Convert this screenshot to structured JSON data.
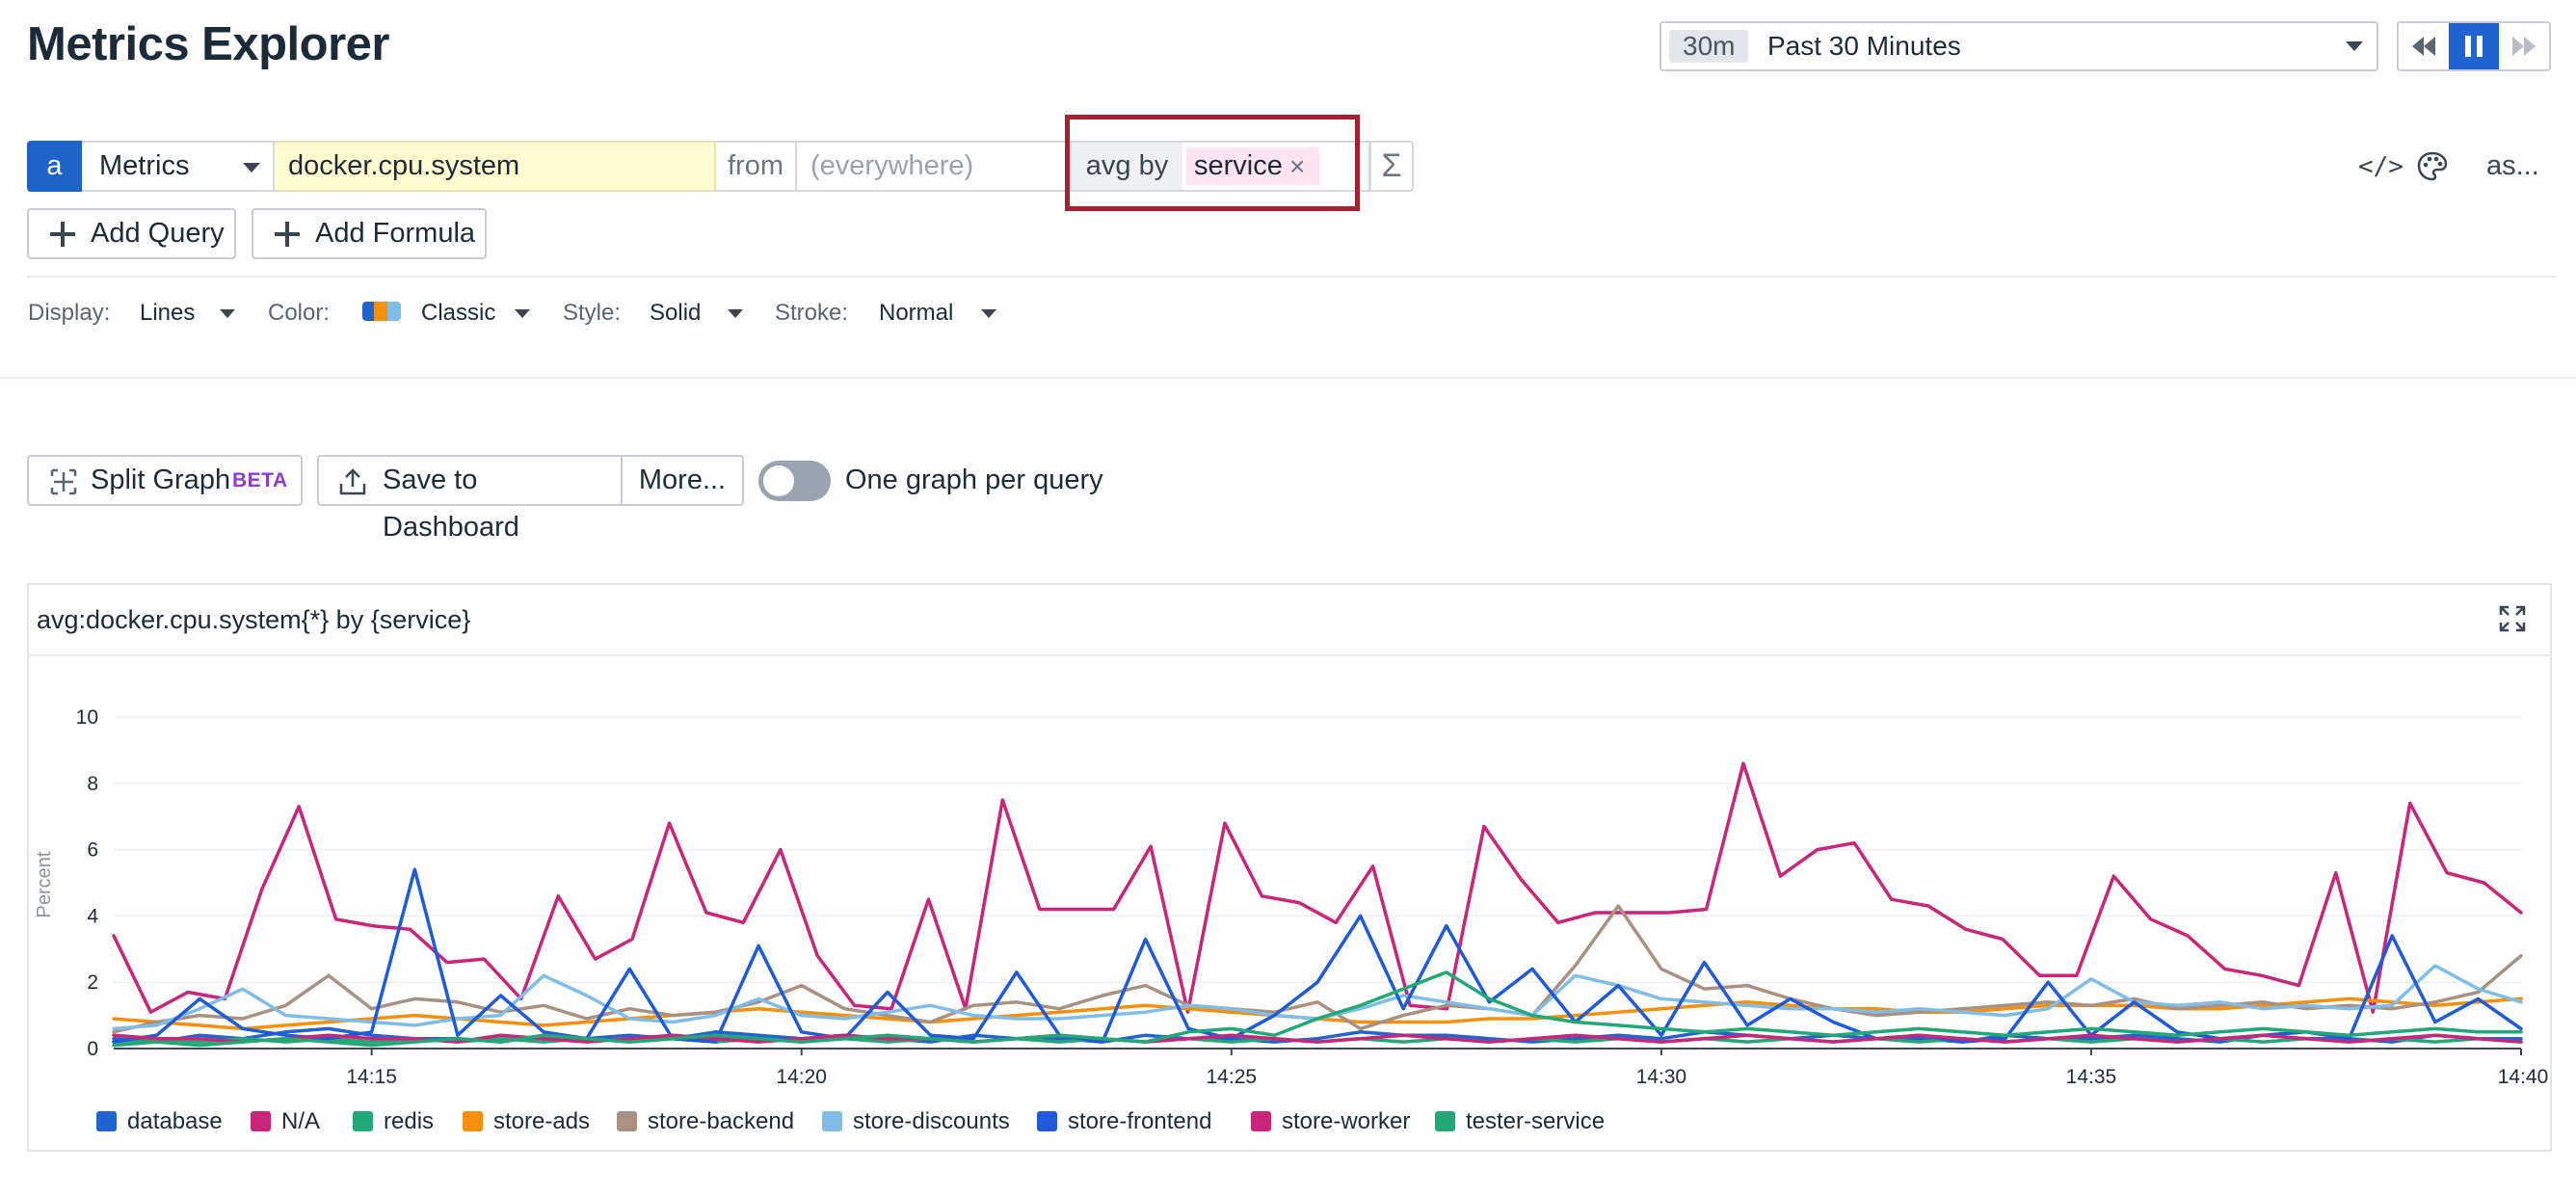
{
  "header": {
    "title": "Metrics Explorer"
  },
  "timepicker": {
    "badge": "30m",
    "label": "Past 30 Minutes"
  },
  "query": {
    "letter": "a",
    "source": "Metrics",
    "metric": "docker.cpu.system",
    "from_label": "from",
    "from_placeholder": "(everywhere)",
    "aggregation": "avg by",
    "group_tag": "service",
    "remove_glyph": "×",
    "sigma": "Σ",
    "code_icon": "</>",
    "as_label": "as..."
  },
  "actions": {
    "add_query": "Add Query",
    "add_formula": "Add Formula"
  },
  "options": {
    "display_label": "Display:",
    "display_value": "Lines",
    "color_label": "Color:",
    "color_value": "Classic",
    "style_label": "Style:",
    "style_value": "Solid",
    "stroke_label": "Stroke:",
    "stroke_value": "Normal"
  },
  "toolbar": {
    "split_graph": "Split Graph",
    "beta": "BETA",
    "save_dashboard": "Save to Dashboard",
    "more": "More...",
    "one_graph_label": "One graph per query",
    "one_graph_on": false
  },
  "panel": {
    "title": "avg:docker.cpu.system{*} by {service}"
  },
  "colors": {
    "accent": "#1f64cf",
    "highlight_border": "#a3212c"
  },
  "chart_data": {
    "type": "line",
    "ylabel": "Percent",
    "ylim": [
      0,
      10
    ],
    "yticks": [
      "0",
      "2",
      "4",
      "6",
      "8",
      "10"
    ],
    "x_minutes_from_1412": [
      0,
      0.5,
      1,
      1.5,
      2,
      2.5,
      3,
      3.5,
      4,
      4.5,
      5,
      5.5,
      6,
      6.5,
      7,
      7.5,
      8,
      8.5,
      9,
      9.5,
      10,
      10.5,
      11,
      11.5,
      12,
      12.5,
      13,
      13.5,
      14,
      14.5,
      15,
      15.5,
      16,
      16.5,
      17,
      17.5,
      18,
      18.5,
      19,
      19.5,
      20,
      20.5,
      21,
      21.5,
      22,
      22.5,
      23,
      23.5,
      24,
      24.5,
      25,
      25.5,
      26,
      26.5,
      27,
      27.5,
      28
    ],
    "xticks": [
      "14:15",
      "14:20",
      "14:25",
      "14:30",
      "14:35",
      "14:40"
    ],
    "series": [
      {
        "name": "database",
        "color": "#1f64cf",
        "values": [
          0.3,
          0.2,
          0.4,
          0.3,
          0.5,
          0.6,
          0.4,
          0.3,
          0.3,
          0.2,
          0.4,
          0.3,
          0.4,
          0.3,
          0.5,
          0.4,
          0.3,
          0.4,
          0.3,
          0.2,
          0.4,
          0.3,
          0.3,
          0.2,
          0.4,
          0.3,
          0.3,
          0.2,
          0.3,
          0.5,
          0.4,
          0.4,
          0.3,
          0.2,
          0.3,
          0.4,
          0.3,
          0.5,
          0.4,
          0.3,
          0.4,
          0.3,
          0.3,
          0.2,
          0.4,
          0.3,
          0.3,
          0.4,
          0.3,
          0.2,
          0.4,
          0.3,
          0.3,
          0.2,
          0.4,
          0.3,
          0.3
        ]
      },
      {
        "name": "N/A",
        "color": "#c9267a",
        "values": [
          3.4,
          1.1,
          1.7,
          1.5,
          4.8,
          7.3,
          3.9,
          3.7,
          3.6,
          2.6,
          2.7,
          1.5,
          4.6,
          2.7,
          3.3,
          6.8,
          4.1,
          3.8,
          6.0,
          2.8,
          1.3,
          1.2,
          4.5,
          1.2,
          7.5,
          4.2,
          4.2,
          4.2,
          6.1,
          1.1,
          6.8,
          4.6,
          4.4,
          3.8,
          5.5,
          1.3,
          1.2,
          6.7,
          5.1,
          3.8,
          4.1,
          4.1,
          4.1,
          4.2,
          8.6,
          5.2,
          6.0,
          6.2,
          4.5,
          4.3,
          3.6,
          3.3,
          2.2,
          2.2,
          5.2,
          3.9,
          3.4,
          2.4,
          2.2,
          1.9,
          5.3,
          1.1,
          7.4,
          5.3,
          5.0,
          4.1
        ]
      },
      {
        "name": "redis",
        "color": "#22a876",
        "values": [
          0.2,
          0.3,
          0.2,
          0.3,
          0.2,
          0.3,
          0.2,
          0.3,
          0.2,
          0.3,
          0.2,
          0.3,
          0.2,
          0.3,
          0.2,
          0.3,
          0.2,
          0.3,
          0.2,
          0.3,
          0.2,
          0.3,
          0.2,
          0.3,
          0.2,
          0.3,
          0.2,
          0.3,
          0.2,
          0.3,
          0.2,
          0.3,
          0.2,
          0.3,
          0.2,
          0.3,
          0.2,
          0.3,
          0.2,
          0.3,
          0.2,
          0.3,
          0.2,
          0.3,
          0.2,
          0.3,
          0.2,
          0.3,
          0.2,
          0.3,
          0.2,
          0.3,
          0.2,
          0.3,
          0.2,
          0.3,
          0.2
        ]
      },
      {
        "name": "store-ads",
        "color": "#f4900c",
        "values": [
          0.9,
          0.8,
          0.7,
          0.6,
          0.7,
          0.8,
          0.9,
          1.0,
          0.9,
          0.8,
          0.7,
          0.8,
          0.9,
          1.0,
          1.1,
          1.2,
          1.1,
          1.0,
          0.9,
          0.8,
          0.9,
          1.0,
          1.1,
          1.2,
          1.3,
          1.2,
          1.1,
          1.0,
          0.9,
          0.8,
          0.8,
          0.8,
          0.9,
          0.9,
          1.0,
          1.1,
          1.2,
          1.3,
          1.4,
          1.3,
          1.2,
          1.2,
          1.1,
          1.1,
          1.2,
          1.3,
          1.3,
          1.3,
          1.2,
          1.2,
          1.3,
          1.4,
          1.5,
          1.4,
          1.3,
          1.4,
          1.5
        ]
      },
      {
        "name": "store-backend",
        "color": "#a89181",
        "values": [
          0.5,
          0.8,
          1.0,
          0.9,
          1.3,
          2.2,
          1.2,
          1.5,
          1.4,
          1.1,
          1.3,
          0.9,
          1.2,
          1.0,
          1.1,
          1.4,
          1.9,
          1.2,
          1.0,
          0.8,
          1.3,
          1.4,
          1.2,
          1.6,
          1.9,
          1.3,
          1.2,
          1.1,
          1.4,
          0.6,
          1.0,
          1.3,
          1.2,
          1.0,
          2.5,
          4.3,
          2.4,
          1.8,
          1.9,
          1.5,
          1.2,
          1.0,
          1.1,
          1.2,
          1.3,
          1.4,
          1.3,
          1.5,
          1.2,
          1.3,
          1.4,
          1.2,
          1.3,
          1.2,
          1.4,
          1.7,
          2.8
        ]
      },
      {
        "name": "store-discounts",
        "color": "#7fbde8",
        "values": [
          0.6,
          0.7,
          1.2,
          1.8,
          1.0,
          0.9,
          0.8,
          0.7,
          0.9,
          1.0,
          2.2,
          1.6,
          0.9,
          0.8,
          1.0,
          1.5,
          1.0,
          0.9,
          1.1,
          1.3,
          1.0,
          0.9,
          0.9,
          1.0,
          1.1,
          1.3,
          1.2,
          1.0,
          0.9,
          1.2,
          1.6,
          1.4,
          1.2,
          1.0,
          2.2,
          1.9,
          1.5,
          1.4,
          1.3,
          1.2,
          1.2,
          1.1,
          1.2,
          1.1,
          1.0,
          1.2,
          2.1,
          1.4,
          1.3,
          1.4,
          1.2,
          1.3,
          1.2,
          1.3,
          2.5,
          1.8,
          1.4
        ]
      },
      {
        "name": "store-frontend",
        "color": "#1f5bd8",
        "values": [
          0.2,
          0.4,
          1.5,
          0.6,
          0.4,
          0.3,
          0.5,
          5.4,
          0.4,
          1.6,
          0.5,
          0.3,
          2.4,
          0.3,
          0.2,
          3.1,
          0.5,
          0.3,
          1.7,
          0.4,
          0.3,
          2.3,
          0.4,
          0.2,
          3.3,
          0.6,
          0.3,
          1.0,
          2.0,
          4.0,
          1.2,
          3.7,
          1.4,
          2.4,
          0.8,
          1.9,
          0.4,
          2.6,
          0.7,
          1.5,
          0.8,
          0.3,
          0.4,
          0.2,
          0.3,
          2.0,
          0.4,
          1.4,
          0.5,
          0.3,
          0.4,
          0.5,
          0.3,
          3.4,
          0.8,
          1.5,
          0.6
        ]
      },
      {
        "name": "store-worker",
        "color": "#c9267a",
        "values": [
          0.4,
          0.3,
          0.3,
          0.2,
          0.3,
          0.4,
          0.3,
          0.3,
          0.2,
          0.4,
          0.3,
          0.2,
          0.3,
          0.4,
          0.3,
          0.2,
          0.3,
          0.4,
          0.3,
          0.3,
          0.2,
          0.3,
          0.4,
          0.3,
          0.2,
          0.3,
          0.4,
          0.3,
          0.2,
          0.3,
          0.4,
          0.3,
          0.2,
          0.3,
          0.4,
          0.3,
          0.2,
          0.3,
          0.4,
          0.3,
          0.2,
          0.3,
          0.4,
          0.3,
          0.2,
          0.3,
          0.4,
          0.3,
          0.2,
          0.3,
          0.4,
          0.3,
          0.2,
          0.3,
          0.4,
          0.3,
          0.2
        ]
      },
      {
        "name": "tester-service",
        "color": "#22a876",
        "values": [
          0.1,
          0.2,
          0.1,
          0.2,
          0.3,
          0.2,
          0.1,
          0.2,
          0.3,
          0.2,
          0.4,
          0.3,
          0.2,
          0.3,
          0.4,
          0.3,
          0.2,
          0.3,
          0.4,
          0.3,
          0.2,
          0.3,
          0.4,
          0.3,
          0.2,
          0.5,
          0.6,
          0.4,
          0.9,
          1.3,
          1.8,
          2.3,
          1.5,
          1.0,
          0.8,
          0.7,
          0.6,
          0.5,
          0.6,
          0.5,
          0.4,
          0.5,
          0.6,
          0.5,
          0.4,
          0.5,
          0.6,
          0.5,
          0.4,
          0.5,
          0.6,
          0.5,
          0.4,
          0.5,
          0.6,
          0.5,
          0.5
        ]
      }
    ]
  }
}
